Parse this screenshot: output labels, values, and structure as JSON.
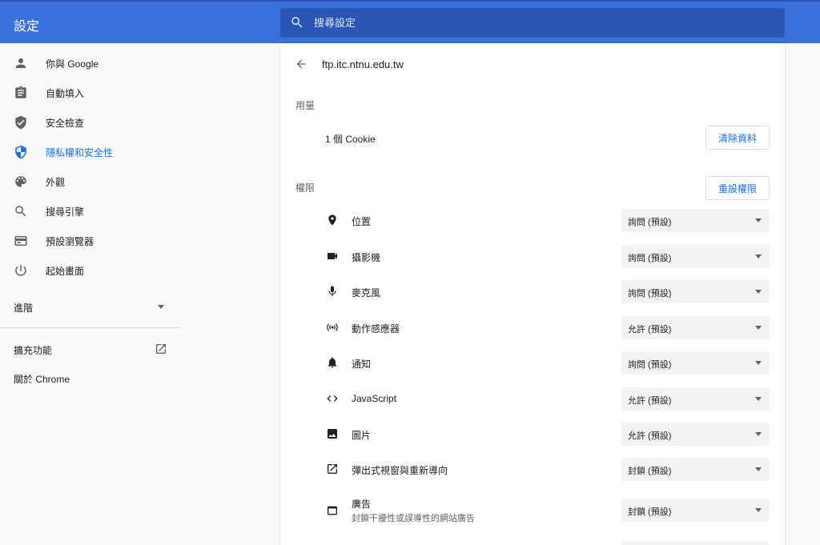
{
  "header": {
    "title": "設定"
  },
  "search": {
    "placeholder": "搜尋設定"
  },
  "sidebar": {
    "items": [
      {
        "label": "你與 Google",
        "icon": "person-icon"
      },
      {
        "label": "自動填入",
        "icon": "clipboard-icon"
      },
      {
        "label": "安全檢查",
        "icon": "shield-check-icon"
      },
      {
        "label": "隱私權和安全性",
        "icon": "shield-icon",
        "active": true
      },
      {
        "label": "外觀",
        "icon": "palette-icon"
      },
      {
        "label": "搜尋引擎",
        "icon": "search-icon"
      },
      {
        "label": "預設瀏覽器",
        "icon": "browser-icon"
      },
      {
        "label": "起始畫面",
        "icon": "power-icon"
      }
    ],
    "advanced": "進階",
    "extensions": "擴充功能",
    "about": "關於 Chrome"
  },
  "site": {
    "title": "ftp.itc.ntnu.edu.tw",
    "usage_label": "用量",
    "cookie_text": "1 個 Cookie",
    "clear_button": "清除資料",
    "permissions_label": "權限",
    "reset_button": "重設權限",
    "permissions": [
      {
        "label": "位置",
        "value": "詢問 (預設)",
        "icon": "location-pin-icon"
      },
      {
        "label": "攝影機",
        "value": "詢問 (預設)",
        "icon": "camera-icon"
      },
      {
        "label": "麥克風",
        "value": "詢問 (預設)",
        "icon": "microphone-icon"
      },
      {
        "label": "動作感應器",
        "value": "允許 (預設)",
        "icon": "sensors-icon"
      },
      {
        "label": "通知",
        "value": "詢問 (預設)",
        "icon": "bell-icon"
      },
      {
        "label": "JavaScript",
        "value": "允許 (預設)",
        "icon": "code-icon"
      },
      {
        "label": "圖片",
        "value": "允許 (預設)",
        "icon": "image-icon"
      },
      {
        "label": "彈出式視窗與重新導向",
        "value": "封鎖 (預設)",
        "icon": "open-in-new-icon"
      },
      {
        "label": "廣告",
        "sublabel": "封鎖干擾性或誤導性的網站廣告",
        "value": "封鎖 (預設)",
        "icon": "ads-window-icon"
      }
    ]
  },
  "colors": {
    "header": "#3b6fd9",
    "search_bg": "#2a56b5",
    "accent": "#1a73e8"
  }
}
